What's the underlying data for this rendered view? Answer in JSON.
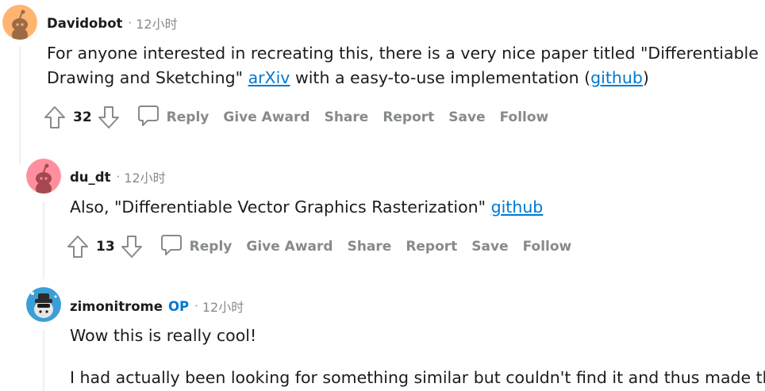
{
  "comments": [
    {
      "username": "Davidobot",
      "time": "12小时",
      "body": {
        "t1": "For anyone interested in recreating this, there is a very nice paper titled \"Differentiable",
        "t2": "Drawing and Sketching\" ",
        "link1": "arXiv",
        "t3": " with a easy-to-use implementation (",
        "link2": "github",
        "t4": ")"
      },
      "score": "32"
    },
    {
      "username": "du_dt",
      "time": "12小时",
      "body": {
        "t1": "Also, \"Differentiable Vector Graphics Rasterization\" ",
        "link1": "github"
      },
      "score": "13"
    },
    {
      "username": "zimonitrome",
      "badge": "OP",
      "time": "12小时",
      "body": {
        "p1": "Wow this is really cool!",
        "p2": "I had actually been looking for something similar but couldn't find it and thus made this."
      }
    }
  ],
  "actions": {
    "reply": "Reply",
    "give_award": "Give Award",
    "share": "Share",
    "report": "Report",
    "save": "Save",
    "follow": "Follow"
  },
  "separator": "·",
  "icons": [
    "snoo-avatar-orange",
    "snoo-avatar-pink",
    "snoo-avatar-hat",
    "upvote-arrow-icon",
    "downvote-arrow-icon",
    "comment-bubble-icon"
  ],
  "colors": {
    "link": "#0079d3",
    "op_badge": "#0079d3",
    "meta": "#878a8c",
    "text": "#1c1c1c",
    "thread_line": "#edeff1",
    "avatar_orange": "#ffb470",
    "avatar_pink": "#ff8f9e",
    "avatar_blue": "#3a9fd6"
  }
}
